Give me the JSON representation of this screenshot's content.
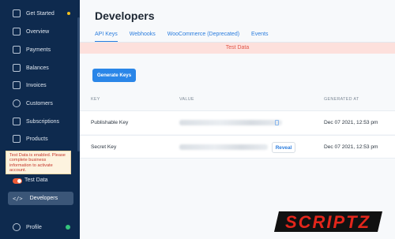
{
  "sidebar": {
    "items": [
      {
        "label": "Get Started",
        "icon": "shield-check-icon"
      },
      {
        "label": "Overview",
        "icon": "chart-line-icon"
      },
      {
        "label": "Payments",
        "icon": "credit-card-icon"
      },
      {
        "label": "Balances",
        "icon": "wallet-icon"
      },
      {
        "label": "Invoices",
        "icon": "invoice-icon"
      },
      {
        "label": "Customers",
        "icon": "user-icon"
      },
      {
        "label": "Subscriptions",
        "icon": "calendar-icon"
      },
      {
        "label": "Products",
        "icon": "box-icon"
      }
    ],
    "warning": "Test Data is enabled. Please complete business information to activate account.",
    "test_data_label": "Test Data",
    "active": {
      "label": "Developers",
      "icon_text": "</>"
    },
    "profile_label": "Profile"
  },
  "main": {
    "title": "Developers",
    "tabs": [
      "API Keys",
      "Webhooks",
      "WooCommerce (Deprecated)",
      "Events"
    ],
    "banner": "Test Data",
    "generate_button": "Generate Keys",
    "table": {
      "headers": [
        "KEY",
        "VALUE",
        "GENERATED AT"
      ],
      "rows": [
        {
          "name": "Publishable Key",
          "date": "Dec 07 2021, 12:53 pm"
        },
        {
          "name": "Secret Key",
          "date": "Dec 07 2021, 12:53 pm",
          "action": "Reveal"
        }
      ]
    }
  },
  "watermark": "SCRIPTZ",
  "colors": {
    "sidebar": "#0e2a4e",
    "accent": "#2a86e8",
    "banner": "#fde0dc",
    "watermark": "#e3261b"
  }
}
